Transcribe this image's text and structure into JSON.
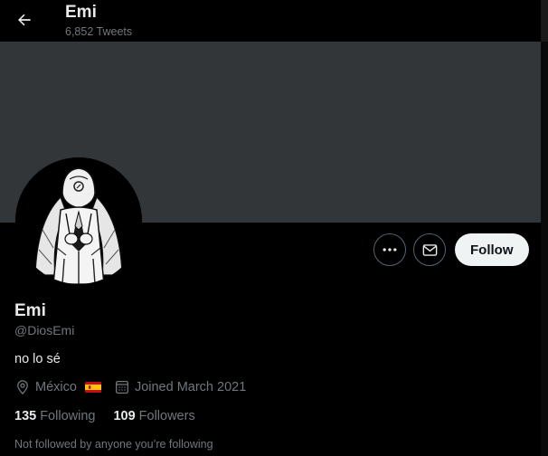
{
  "header": {
    "title": "Emi",
    "tweet_count": "6,852",
    "tweet_label": "Tweets"
  },
  "banner_color": "#333639",
  "profile": {
    "display_name": "Emi",
    "handle": "@DiosEmi",
    "bio": "no lo sé",
    "location": "México",
    "joined": "Joined March 2021",
    "following_count": "135",
    "following_label": "Following",
    "followers_count": "109",
    "followers_label": "Followers",
    "not_followed_text": "Not followed by anyone you’re following"
  },
  "actions": {
    "more_icon": "more-icon",
    "message_icon": "envelope-icon",
    "follow_label": "Follow"
  },
  "colors": {
    "background": "#000000",
    "text_primary": "#e7e9ea",
    "text_secondary": "#71767b",
    "follow_bg": "#eff3f4",
    "follow_text": "#0f1419",
    "outline": "#536471"
  }
}
